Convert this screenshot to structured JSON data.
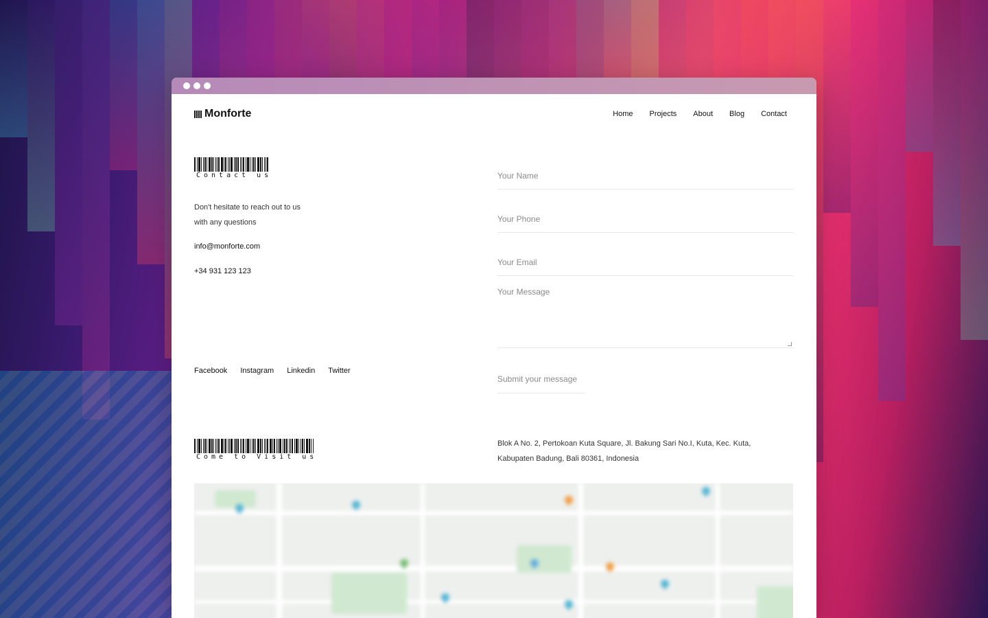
{
  "window": {
    "title": "Monforte"
  },
  "brand": {
    "name": "Monforte"
  },
  "nav": {
    "items": [
      "Home",
      "Projects",
      "About",
      "Blog",
      "Contact"
    ]
  },
  "contact": {
    "heading": "Contact us",
    "intro_line1": "Don't hesitate to reach out to us",
    "intro_line2": "with any questions",
    "email": "info@monforte.com",
    "phone": "+34 931 123 123"
  },
  "socials": [
    "Facebook",
    "Instagram",
    "Linkedin",
    "Twitter"
  ],
  "form": {
    "name_placeholder": "Your Name",
    "phone_placeholder": "Your Phone",
    "email_placeholder": "Your Email",
    "message_placeholder": "Your Message",
    "submit_label": "Submit your message"
  },
  "visit": {
    "heading": "Come to Visit us",
    "address_line1": "Blok A No. 2, Pertokoan Kuta Square, Jl. Bakung Sari No.I, Kuta, Kec. Kuta,",
    "address_line2": "Kabupaten Badung, Bali 80361, Indonesia"
  },
  "colors": {
    "text": "#111111",
    "muted": "#8a8a8a",
    "divider": "#e8e8e8",
    "window_bar": "#b58ab8"
  }
}
